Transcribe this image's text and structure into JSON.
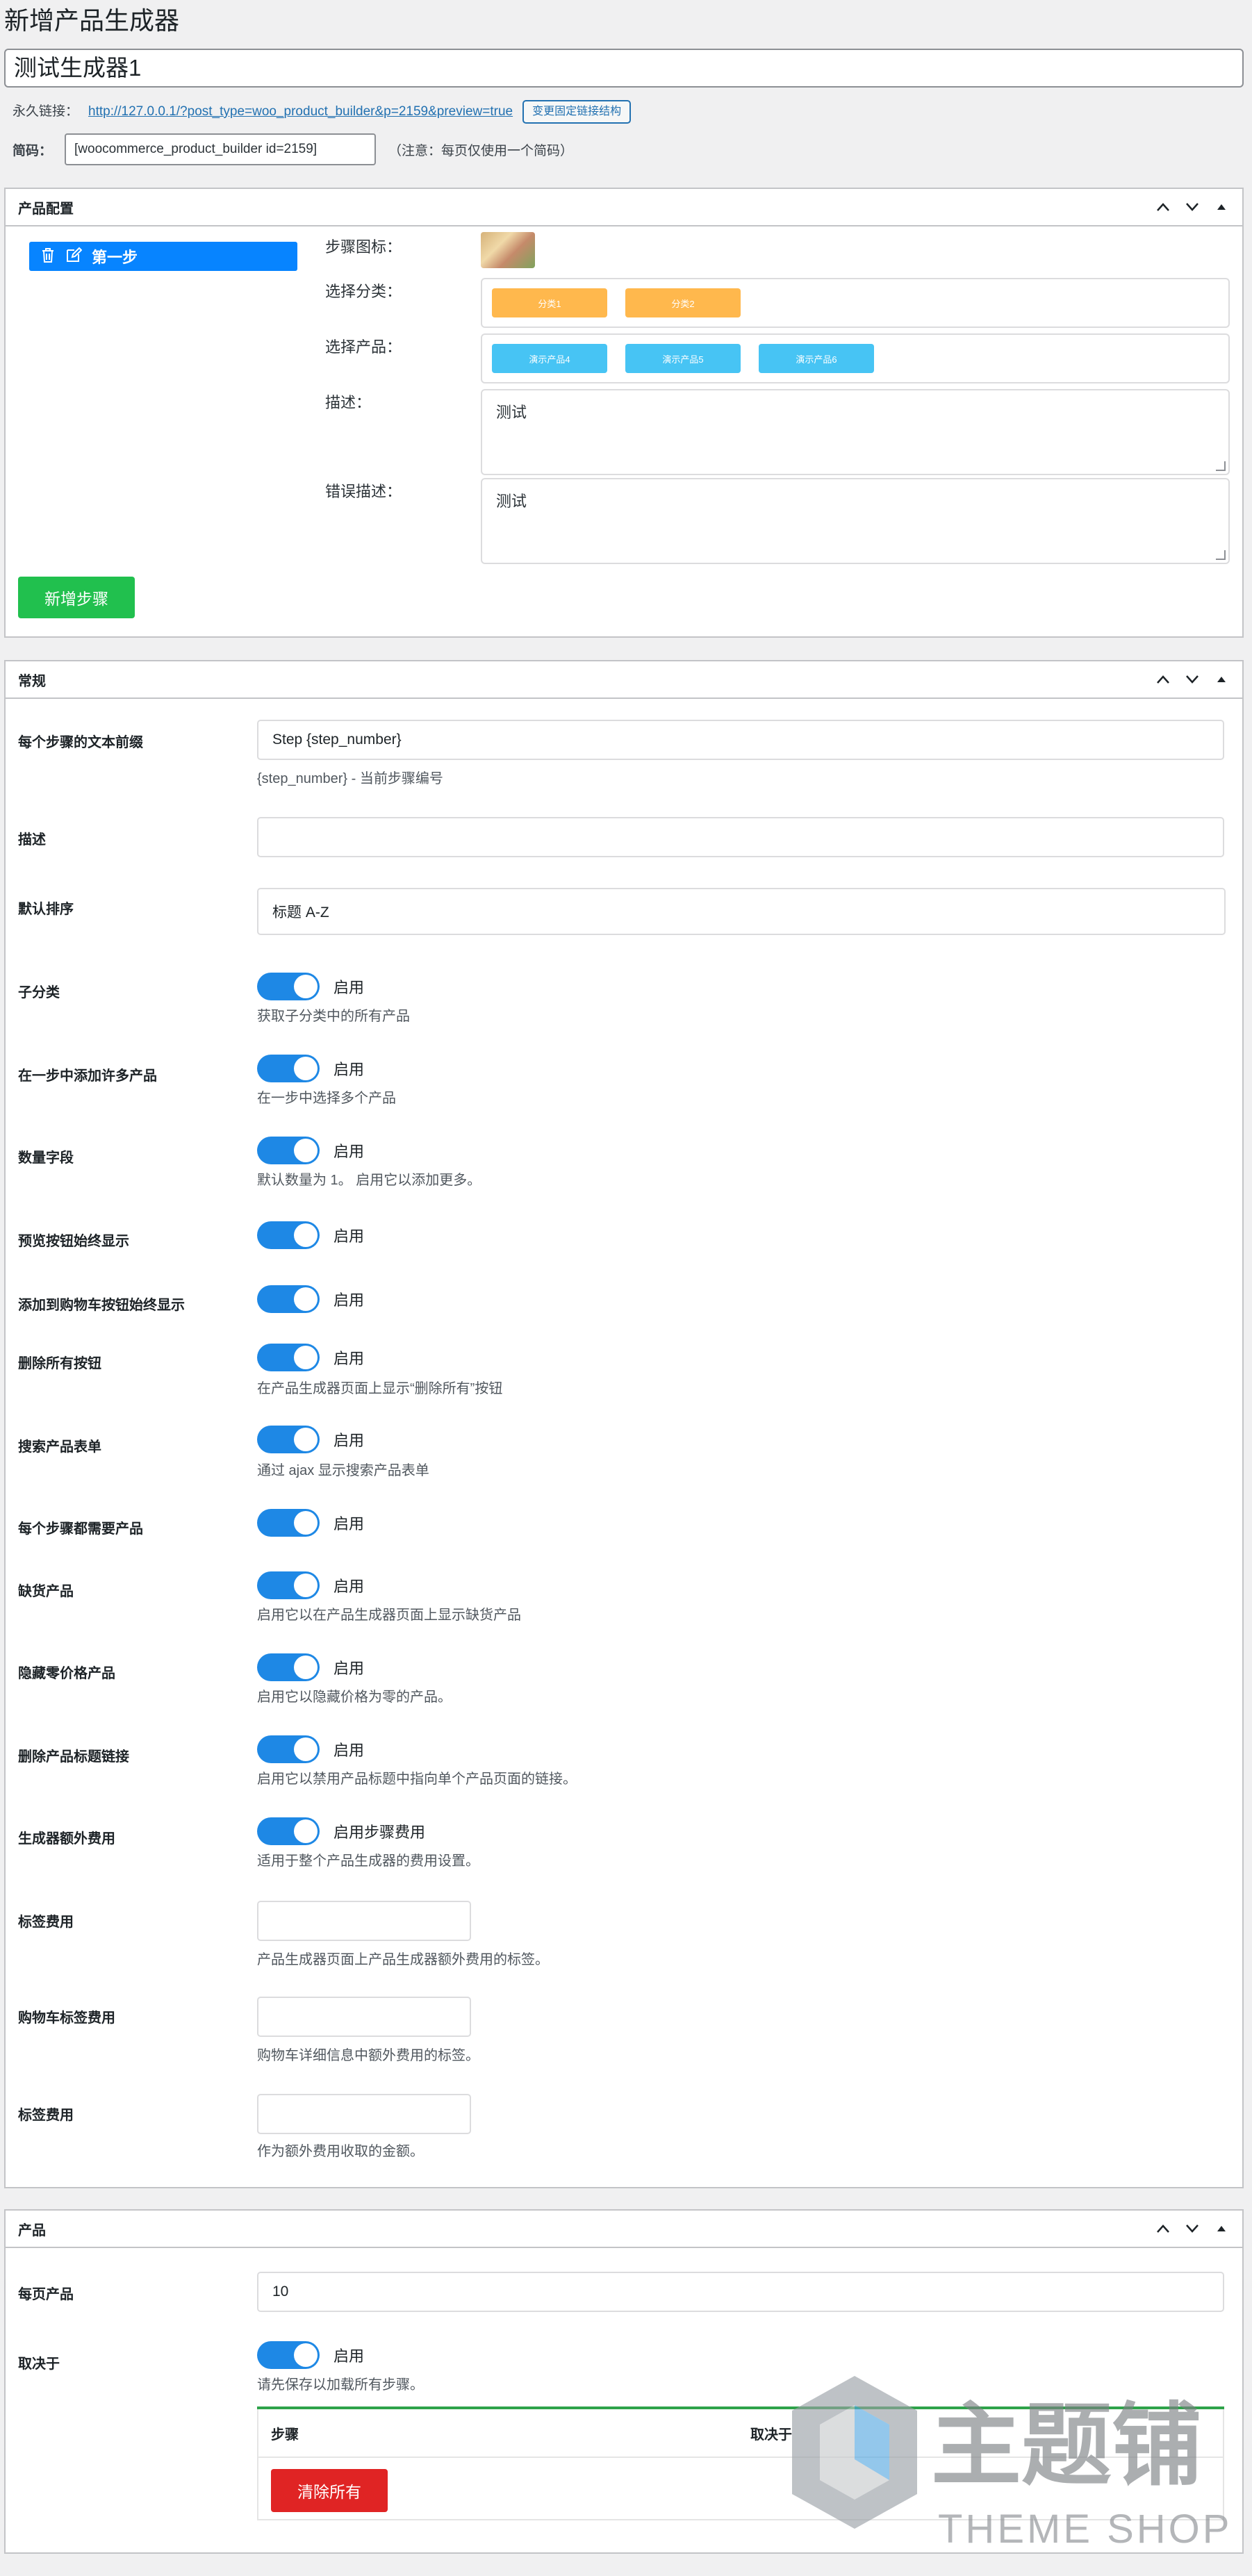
{
  "page": {
    "title": "新增产品生成器"
  },
  "post": {
    "title": "测试生成器1",
    "permalink_label": "永久链接：",
    "permalink_url": "http://127.0.0.1/?post_type=woo_product_builder&p=2159&preview=true",
    "permalink_button": "变更固定链接结构",
    "shortcode_label": "简码：",
    "shortcode_value": "[woocommerce_product_builder id=2159]",
    "shortcode_note": "（注意：每页仅使用一个简码）"
  },
  "product_config": {
    "title": "产品配置",
    "step_name": "第一步",
    "step_icon_label": "步骤图标：",
    "select_category_label": "选择分类：",
    "categories": [
      "分类1",
      "分类2"
    ],
    "select_product_label": "选择产品：",
    "products": [
      "演示产品4",
      "演示产品5",
      "演示产品6"
    ],
    "description_label": "描述：",
    "description_value": "测试",
    "error_description_label": "错误描述：",
    "error_description_value": "测试",
    "add_step_button": "新增步骤"
  },
  "general": {
    "title": "常规",
    "prefix_label": "每个步骤的文本前缀",
    "prefix_value": "Step {step_number}",
    "prefix_help": "{step_number} - 当前步骤编号",
    "description_label": "描述",
    "description_value": "",
    "sort_label": "默认排序",
    "sort_value": "标题 A-Z",
    "toggles": [
      {
        "label": "子分类",
        "text": "启用",
        "help": "获取子分类中的所有产品"
      },
      {
        "label": "在一步中添加许多产品",
        "text": "启用",
        "help": "在一步中选择多个产品"
      },
      {
        "label": "数量字段",
        "text": "启用",
        "help": "默认数量为 1。 启用它以添加更多。"
      },
      {
        "label": "预览按钮始终显示",
        "text": "启用",
        "help": ""
      },
      {
        "label": "添加到购物车按钮始终显示",
        "text": "启用",
        "help": ""
      },
      {
        "label": "删除所有按钮",
        "text": "启用",
        "help": "在产品生成器页面上显示“删除所有”按钮"
      },
      {
        "label": "搜索产品表单",
        "text": "启用",
        "help": "通过 ajax 显示搜索产品表单"
      },
      {
        "label": "每个步骤都需要产品",
        "text": "启用",
        "help": ""
      },
      {
        "label": "缺货产品",
        "text": "启用",
        "help": "启用它以在产品生成器页面上显示缺货产品"
      },
      {
        "label": "隐藏零价格产品",
        "text": "启用",
        "help": "启用它以隐藏价格为零的产品。"
      },
      {
        "label": "删除产品标题链接",
        "text": "启用",
        "help": "启用它以禁用产品标题中指向单个产品页面的链接。"
      },
      {
        "label": "生成器额外费用",
        "text": "启用步骤费用",
        "help": "适用于整个产品生成器的费用设置。"
      }
    ],
    "fee_label_1": "标签费用",
    "fee_help_1": "产品生成器页面上产品生成器额外费用的标签。",
    "fee_label_2": "购物车标签费用",
    "fee_help_2": "购物车详细信息中额外费用的标签。",
    "fee_label_3": "标签费用",
    "fee_help_3": "作为额外费用收取的金额。"
  },
  "products": {
    "title": "产品",
    "per_page_label": "每页产品",
    "per_page_value": "10",
    "depends_label": "取决于",
    "depends_toggle_text": "启用",
    "depends_help": "请先保存以加载所有步骤。",
    "table_col_step": "步骤",
    "table_col_depends": "取决于",
    "clear_all_button": "清除所有"
  },
  "watermark": {
    "main": "主题铺",
    "sub": "THEME SHOP"
  },
  "colors": {
    "accent_blue": "#0784ff",
    "toggle_blue": "#1e88e5",
    "green": "#21c04e",
    "red": "#e02424",
    "orange": "#ffb84d",
    "cyan": "#47c4f4"
  }
}
